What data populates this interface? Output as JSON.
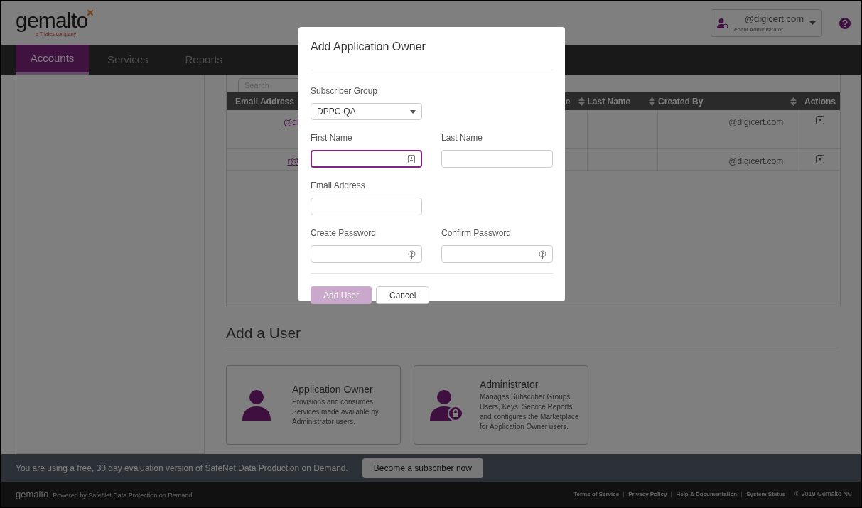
{
  "header": {
    "logo": "gemalto",
    "tagline": "a Thales company",
    "user_menu": {
      "email": "@digicert.com",
      "role": "Tenant Administrator"
    }
  },
  "nav": {
    "tabs": [
      {
        "label": "Accounts",
        "selected": true
      },
      {
        "label": "Services",
        "selected": false
      },
      {
        "label": "Reports",
        "selected": false
      }
    ]
  },
  "search": {
    "placeholder": "Search"
  },
  "table": {
    "columns": [
      {
        "label": "Email Address",
        "sortable": false
      },
      {
        "label": "e",
        "sortable": true
      },
      {
        "label": "Last Name",
        "sortable": true
      },
      {
        "label": "Created By",
        "sortable": true
      },
      {
        "label": "Actions",
        "sortable": false
      }
    ],
    "rows": [
      {
        "email": "@di",
        "created_by": "@digicert.com"
      },
      {
        "email": "r@",
        "created_by": "@digicert.com"
      }
    ]
  },
  "add_user": {
    "title": "Add a User",
    "cards": [
      {
        "kind": "owner",
        "title": "Application Owner",
        "description": "Provisions and consumes Services made available by Administrator users."
      },
      {
        "kind": "admin",
        "title": "Administrator",
        "description": "Manages Subscriber Groups, Users, Keys, Service Reports and configures the Marketplace for Application Owner users."
      }
    ]
  },
  "eval_banner": {
    "text": "You are using a free, 30 day evaluation version of SafeNet Data Production on Demand.",
    "button": "Become a subscriber now"
  },
  "footer": {
    "logo": "gemalto",
    "powered_by": "Powered by SafeNet Data Protection on Demand",
    "links": [
      "Terms of Service",
      "Privacy Policy",
      "Help & Documentation",
      "System Status"
    ],
    "copyright": "© 2019 Gemalto NV"
  },
  "modal": {
    "title": "Add Application Owner",
    "rows": [
      [
        {
          "kind": "select",
          "label": "Subscriber Group",
          "value": "DPPC-QA",
          "focused": false
        }
      ],
      [
        {
          "kind": "text",
          "label": "First Name",
          "focused": true
        },
        {
          "kind": "text",
          "label": "Last Name",
          "focused": false
        }
      ],
      [
        {
          "kind": "text",
          "label": "Email Address",
          "focused": false
        }
      ],
      [
        {
          "kind": "password",
          "label": "Create Password",
          "focused": false
        },
        {
          "kind": "password",
          "label": "Confirm Password",
          "focused": false
        }
      ]
    ],
    "buttons": [
      {
        "kind": "primary",
        "label": "Add User",
        "disabled": true
      },
      {
        "kind": "secondary",
        "label": "Cancel",
        "disabled": false
      }
    ]
  }
}
